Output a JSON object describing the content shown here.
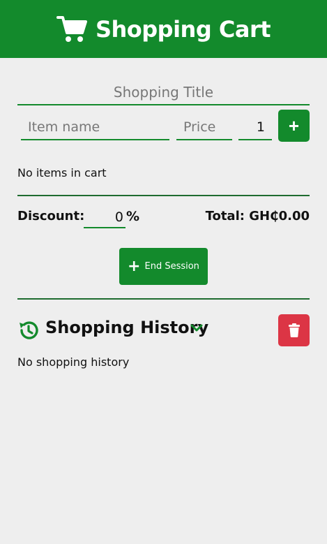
{
  "header": {
    "title": "Shopping Cart",
    "icon": "shopping-cart-icon"
  },
  "form": {
    "title_placeholder": "Shopping Title",
    "item_placeholder": "Item name",
    "price_placeholder": "Price",
    "quantity": "1",
    "add_label": "+"
  },
  "cart": {
    "empty_text": "No items in cart"
  },
  "totals": {
    "discount_label": "Discount:",
    "discount_value": "0",
    "percent_sign": "%",
    "total_text": "Total: GH₵0.00"
  },
  "end_session": {
    "icon": "+",
    "label": "End Session"
  },
  "history": {
    "title": "Shopping History",
    "empty_text": "No shopping history",
    "icons": [
      "history-icon",
      "chevron-down-icon",
      "trash-icon"
    ]
  },
  "colors": {
    "primary": "#138a2c",
    "danger": "#dc3545",
    "background": "#eeeeee"
  }
}
